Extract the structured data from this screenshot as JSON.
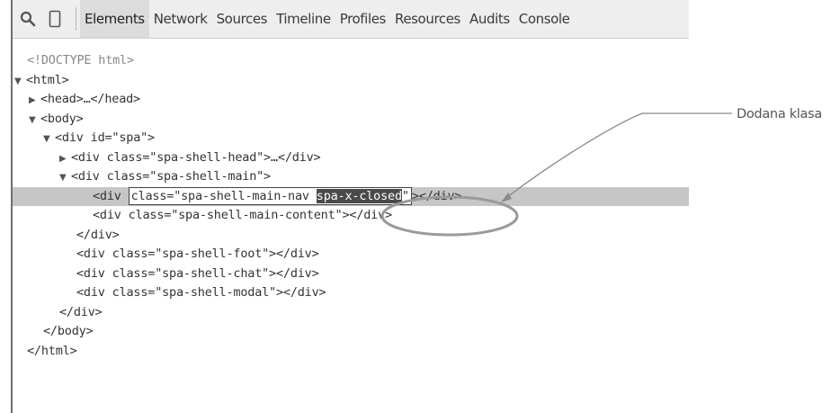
{
  "toolbar": {
    "icons": [
      "search-icon",
      "device-icon"
    ],
    "tabs": [
      {
        "label": "Elements",
        "active": true
      },
      {
        "label": "Network",
        "active": false
      },
      {
        "label": "Sources",
        "active": false
      },
      {
        "label": "Timeline",
        "active": false
      },
      {
        "label": "Profiles",
        "active": false
      },
      {
        "label": "Resources",
        "active": false
      },
      {
        "label": "Audits",
        "active": false
      },
      {
        "label": "Console",
        "active": false
      }
    ]
  },
  "dom_tree": {
    "lines": [
      {
        "text": "<!DOCTYPE html>"
      },
      {
        "text": "<html>",
        "toggle": "expanded"
      },
      {
        "text": "<head>…</head>",
        "toggle": "collapsed"
      },
      {
        "text": "<body>",
        "toggle": "expanded"
      },
      {
        "text": "<div id=\"spa\">",
        "toggle": "expanded"
      },
      {
        "text": "<div class=\"spa-shell-head\">…</div>",
        "toggle": "collapsed"
      },
      {
        "text": "<div class=\"spa-shell-main\">",
        "toggle": "expanded"
      },
      {
        "selected": true,
        "prefix": "<div ",
        "edit_before": "class=\"spa-shell-main-nav ",
        "edit_highlight": "spa-x-closed",
        "edit_after": "\"",
        "suffix": "></div>"
      },
      {
        "text": "<div class=\"spa-shell-main-content\"></div>"
      },
      {
        "text": "</div>"
      },
      {
        "text": "<div class=\"spa-shell-foot\"></div>"
      },
      {
        "text": "<div class=\"spa-shell-chat\"></div>"
      },
      {
        "text": "<div class=\"spa-shell-modal\"></div>"
      },
      {
        "text": "</div>"
      },
      {
        "text": "</body>"
      },
      {
        "text": "</html>"
      }
    ]
  },
  "annotation": {
    "label": "Dodana klasa"
  },
  "colors": {
    "toolbar_bg": "#eeeeee",
    "active_tab_bg": "#dcdcdc",
    "selected_row_bg": "#c6c6c6",
    "highlight_bg": "#4a4a4a"
  }
}
